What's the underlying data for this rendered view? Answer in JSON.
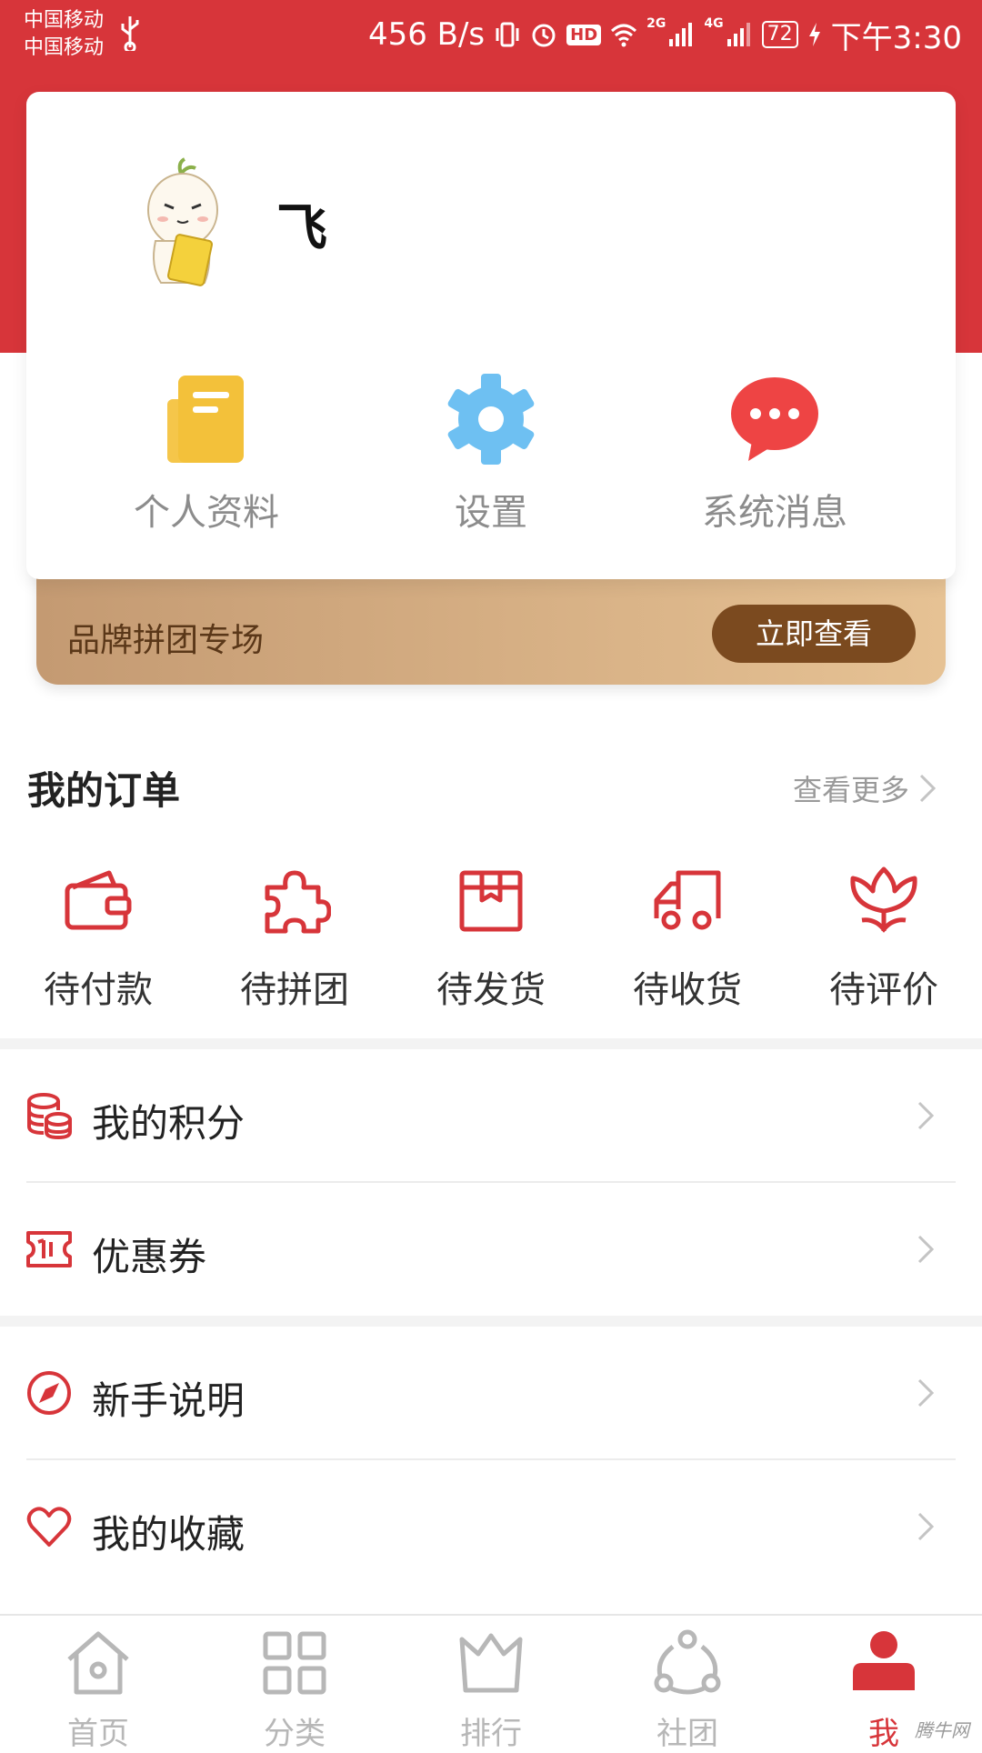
{
  "status_bar": {
    "carrier_1": "中国移动",
    "carrier_2": "中国移动",
    "net_speed": "456 B/s",
    "hd_badge": "HD",
    "net_2g": "2G",
    "net_4g": "4G",
    "battery": "72",
    "time": "下午3:30"
  },
  "profile": {
    "username": "飞"
  },
  "quick_actions": [
    {
      "label": "个人资料",
      "icon": "document-icon"
    },
    {
      "label": "设置",
      "icon": "gear-icon"
    },
    {
      "label": "系统消息",
      "icon": "message-icon"
    }
  ],
  "promo": {
    "title": "品牌拼团专场",
    "button": "立即查看"
  },
  "orders": {
    "title": "我的订单",
    "more": "查看更多",
    "items": [
      {
        "label": "待付款",
        "icon": "wallet-icon"
      },
      {
        "label": "待拼团",
        "icon": "puzzle-icon"
      },
      {
        "label": "待发货",
        "icon": "box-icon"
      },
      {
        "label": "待收货",
        "icon": "truck-icon"
      },
      {
        "label": "待评价",
        "icon": "flower-icon"
      }
    ]
  },
  "menu": [
    {
      "label": "我的积分",
      "icon": "coins-icon"
    },
    {
      "label": "优惠券",
      "icon": "ticket-icon"
    },
    {
      "label": "新手说明",
      "icon": "compass-icon"
    },
    {
      "label": "我的收藏",
      "icon": "heart-icon"
    }
  ],
  "tabs": [
    {
      "label": "首页",
      "icon": "home-icon"
    },
    {
      "label": "分类",
      "icon": "grid-icon"
    },
    {
      "label": "排行",
      "icon": "crown-icon"
    },
    {
      "label": "社团",
      "icon": "community-icon"
    },
    {
      "label": "我",
      "icon": "person-icon",
      "active": true
    }
  ],
  "watermark": "腾牛网",
  "colors": {
    "primary": "#d7353a",
    "promo_button": "#7b4a1f",
    "tab_inactive": "#b7b7b7"
  }
}
